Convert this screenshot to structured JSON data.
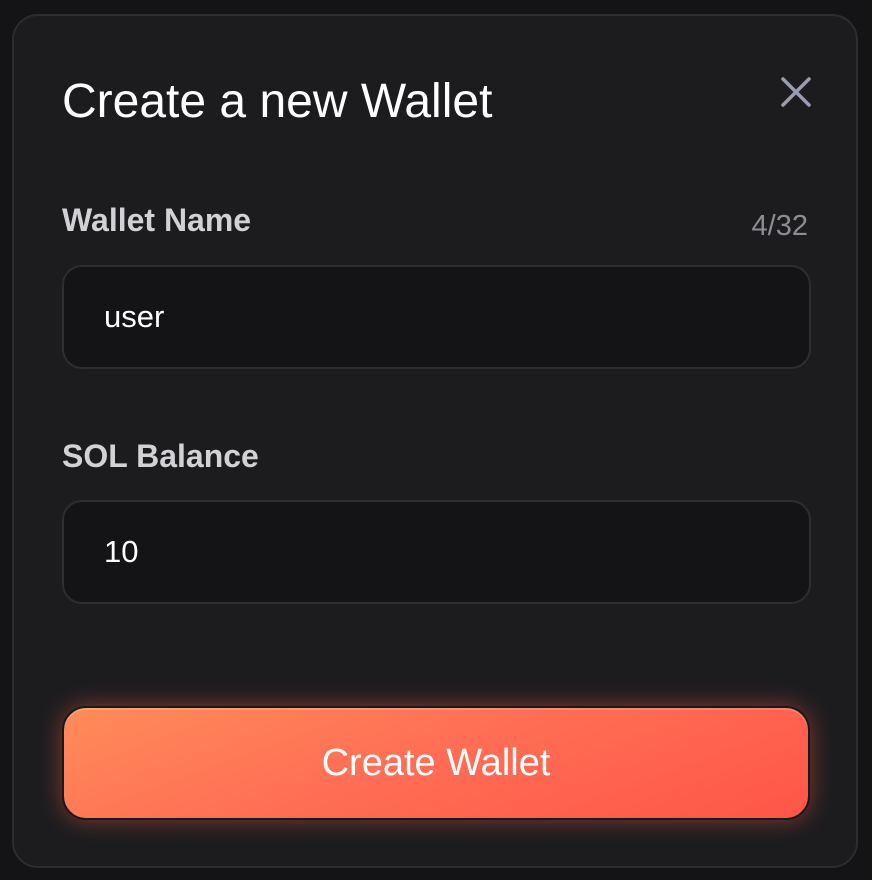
{
  "modal": {
    "title": "Create a new Wallet",
    "close_icon": "close-icon"
  },
  "wallet_name": {
    "label": "Wallet Name",
    "counter": "4/32",
    "value": "user"
  },
  "sol_balance": {
    "label": "SOL Balance",
    "value": "10"
  },
  "actions": {
    "create_label": "Create Wallet"
  },
  "colors": {
    "background": "#141416",
    "modal": "#1c1c1f",
    "button_gradient_start": "#ff8c59",
    "button_gradient_end": "#ff5548"
  }
}
